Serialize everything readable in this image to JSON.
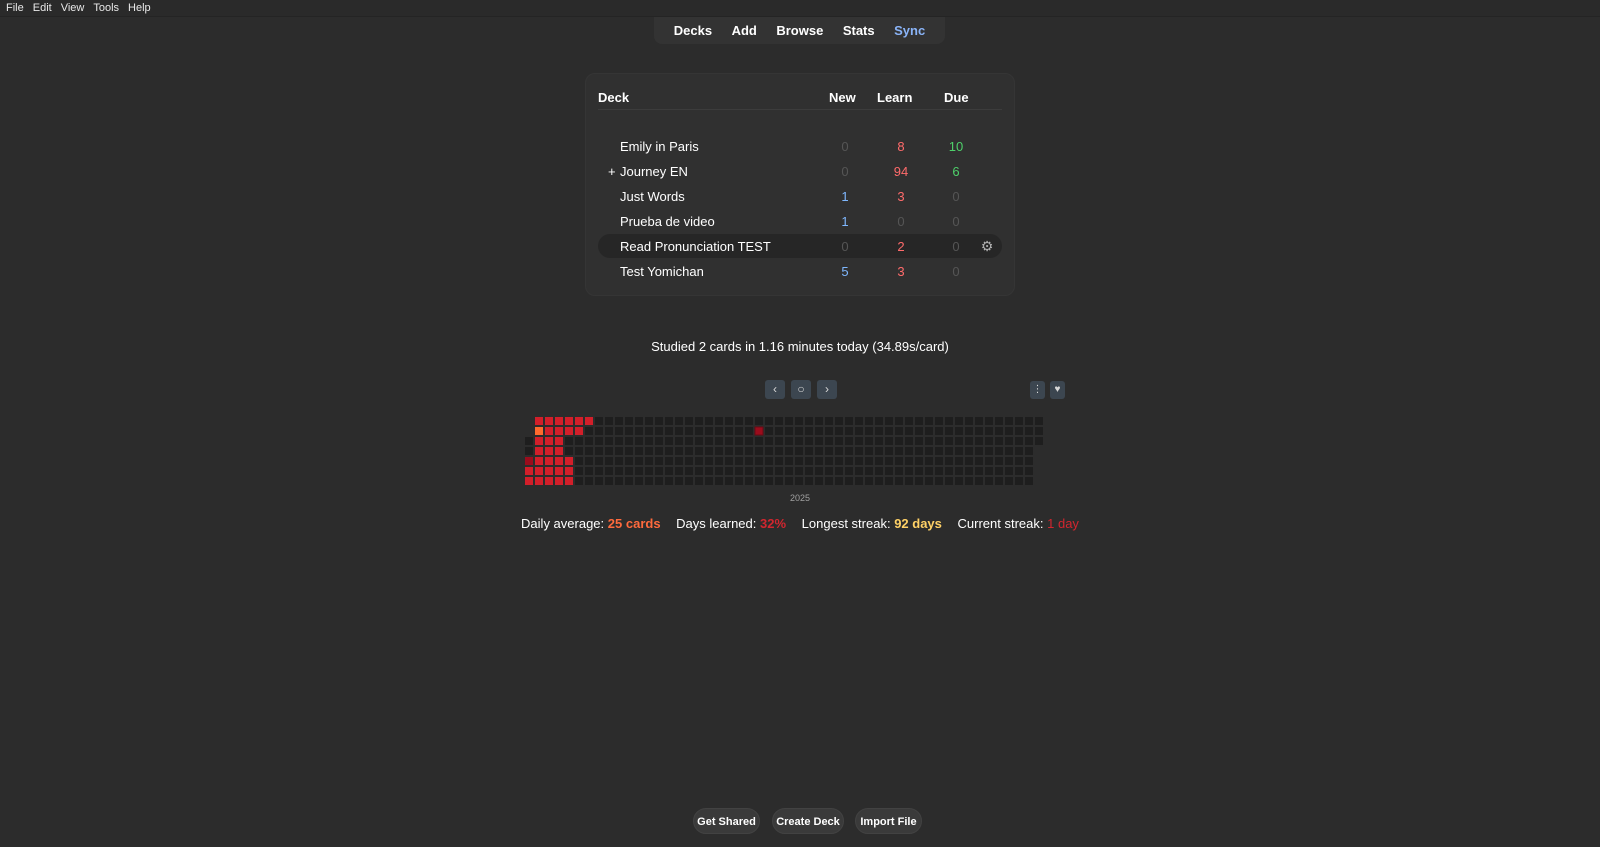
{
  "menu": [
    "File",
    "Edit",
    "View",
    "Tools",
    "Help"
  ],
  "toolbar": {
    "decks": "Decks",
    "add": "Add",
    "browse": "Browse",
    "stats": "Stats",
    "sync": "Sync"
  },
  "deck_table": {
    "headers": {
      "deck": "Deck",
      "new": "New",
      "learn": "Learn",
      "due": "Due"
    },
    "rows": [
      {
        "name": "Emily in Paris",
        "expander": "",
        "new": "0",
        "learn": "8",
        "due": "10"
      },
      {
        "name": "Journey EN",
        "expander": "+",
        "new": "0",
        "learn": "94",
        "due": "6"
      },
      {
        "name": "Just Words",
        "expander": "",
        "new": "1",
        "learn": "3",
        "due": "0"
      },
      {
        "name": "Prueba de video",
        "expander": "",
        "new": "1",
        "learn": "0",
        "due": "0"
      },
      {
        "name": "Read Pronunciation TEST",
        "expander": "",
        "new": "0",
        "learn": "2",
        "due": "0"
      },
      {
        "name": "Test Yomichan",
        "expander": "",
        "new": "5",
        "learn": "3",
        "due": "0"
      }
    ],
    "selected_row": "Read Pronunciation TEST",
    "gear_icon": "gear-icon"
  },
  "studied_text": "Studied 2 cards in 1.16 minutes today (34.89s/card)",
  "heatmap": {
    "year": "2025",
    "controls": {
      "prev": "chevron-left-icon",
      "today": "circle-icon",
      "next": "chevron-right-icon",
      "options": "sliders-icon",
      "heart": "heart-icon"
    },
    "colors": {
      "empty": "#1e1e1e",
      "red": "#d21f2a",
      "dark": "#9a0c1c",
      "orange": "#ff6a2e"
    }
  },
  "summary": {
    "daily_label": "Daily average:",
    "daily_value": "25 cards",
    "days_label": "Days learned:",
    "days_value": "32%",
    "longest_label": "Longest streak:",
    "longest_value": "92 days",
    "current_label": "Current streak:",
    "current_value": "1 day"
  },
  "bottom": {
    "get_shared": "Get Shared",
    "create_deck": "Create Deck",
    "import_file": "Import File"
  }
}
